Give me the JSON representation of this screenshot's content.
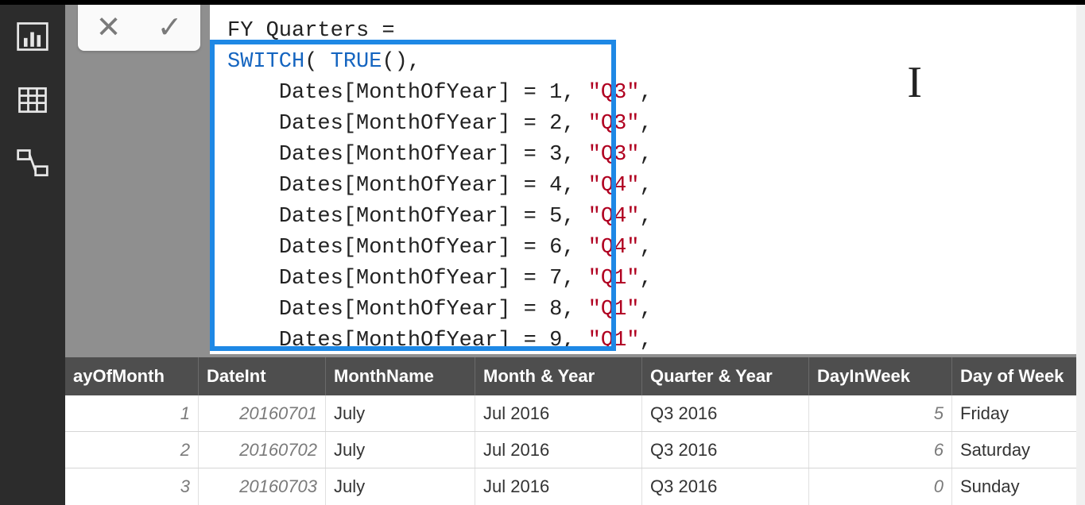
{
  "colors": {
    "highlight_border": "#1e88e5",
    "keyword": "#1565c0",
    "string": "#b00020"
  },
  "nav": {
    "items": [
      {
        "name": "report-view-icon"
      },
      {
        "name": "data-view-icon"
      },
      {
        "name": "model-view-icon"
      }
    ]
  },
  "formula": {
    "measure_name": "FY Quarters",
    "tokens": {
      "switch": "SWITCH",
      "true_fn": "TRUE",
      "col_ref": "Dates[MonthOfYear]",
      "lines": [
        {
          "n": "1",
          "q": "\"Q3\""
        },
        {
          "n": "2",
          "q": "\"Q3\""
        },
        {
          "n": "3",
          "q": "\"Q3\""
        },
        {
          "n": "4",
          "q": "\"Q4\""
        },
        {
          "n": "5",
          "q": "\"Q4\""
        },
        {
          "n": "6",
          "q": "\"Q4\""
        },
        {
          "n": "7",
          "q": "\"Q1\""
        },
        {
          "n": "8",
          "q": "\"Q1\""
        },
        {
          "n": "9",
          "q": "\"Q1\""
        }
      ]
    }
  },
  "grid": {
    "headers": [
      "ayOfMonth",
      "DateInt",
      "MonthName",
      "Month & Year",
      "Quarter & Year",
      "DayInWeek",
      "Day of Week"
    ],
    "rows": [
      {
        "ayOfMonth": "1",
        "DateInt": "20160701",
        "MonthName": "July",
        "MonthYear": "Jul 2016",
        "QuarterYear": "Q3 2016",
        "DayInWeek": "5",
        "DayOfWeek": "Friday"
      },
      {
        "ayOfMonth": "2",
        "DateInt": "20160702",
        "MonthName": "July",
        "MonthYear": "Jul 2016",
        "QuarterYear": "Q3 2016",
        "DayInWeek": "6",
        "DayOfWeek": "Saturday"
      },
      {
        "ayOfMonth": "3",
        "DateInt": "20160703",
        "MonthName": "July",
        "MonthYear": "Jul 2016",
        "QuarterYear": "Q3 2016",
        "DayInWeek": "0",
        "DayOfWeek": "Sunday"
      }
    ]
  },
  "buttons": {
    "cancel_glyph": "✕",
    "accept_glyph": "✓"
  }
}
